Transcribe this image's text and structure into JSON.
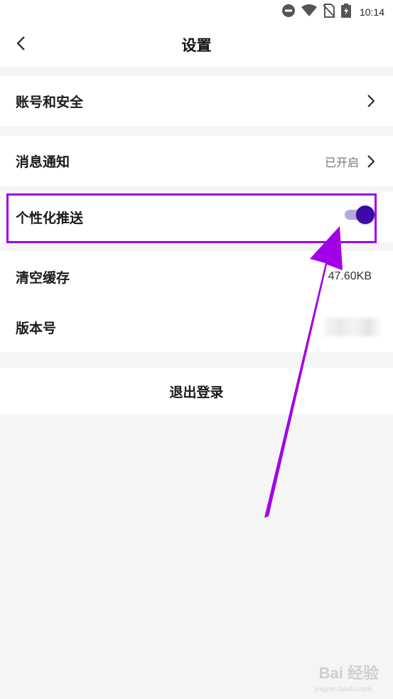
{
  "status_bar": {
    "time": "10:14"
  },
  "header": {
    "title": "设置"
  },
  "rows": {
    "account": {
      "label": "账号和安全"
    },
    "notifications": {
      "label": "消息通知",
      "value": "已开启"
    },
    "personalized_push": {
      "label": "个性化推送",
      "enabled": true
    },
    "clear_cache": {
      "label": "清空缓存",
      "value": "47.60KB"
    },
    "version": {
      "label": "版本号"
    }
  },
  "logout": {
    "label": "退出登录"
  },
  "watermark": {
    "text": "Bai 经验",
    "sub": "jingyan.baidu.com"
  },
  "colors": {
    "highlight": "#a100e8",
    "toggle_knob": "#3d0aa8",
    "toggle_track": "#b9a7e0"
  }
}
